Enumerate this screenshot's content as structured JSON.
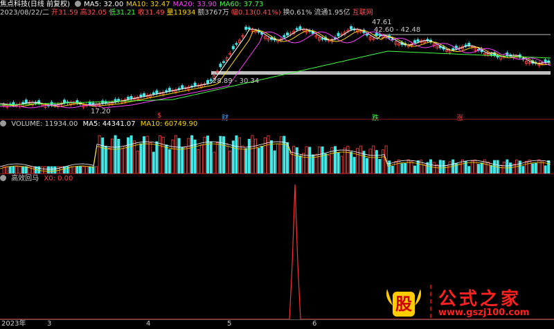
{
  "main": {
    "title": "焦点科技(日线 前复权)",
    "ma_items": [
      {
        "label": "MA5: 32.00",
        "color": "#ffffff"
      },
      {
        "label": "MA10: 32.47",
        "color": "#ffd700"
      },
      {
        "label": "MA20: 33.90",
        "color": "#ff40ff"
      },
      {
        "label": "MA60: 37.73",
        "color": "#40ff40"
      }
    ],
    "info_items": [
      {
        "label": "2023/08/22/二",
        "color": "#cccccc"
      },
      {
        "label": "开31.59",
        "color": "#ff5050"
      },
      {
        "label": "高32.05",
        "color": "#ff5050"
      },
      {
        "label": "低31.21",
        "color": "#40ff40"
      },
      {
        "label": "收31.49",
        "color": "#ff5050"
      },
      {
        "label": "量11934",
        "color": "#ffd700"
      },
      {
        "label": "额3767万",
        "color": "#cccccc"
      },
      {
        "label": "幅0.13(0.41%)",
        "color": "#ff5050"
      },
      {
        "label": "换0.61%",
        "color": "#cccccc"
      },
      {
        "label": "流通1.95亿",
        "color": "#cccccc"
      },
      {
        "label": "互联网",
        "color": "#ff5050"
      }
    ],
    "annotations": {
      "high_price": "47.61",
      "range_top": "42.60 - 42.48",
      "range_mid": "28.89 - 30.34",
      "low_price": "17.20"
    },
    "event_tags": [
      "$",
      "财",
      "跌",
      "涨"
    ]
  },
  "volume": {
    "title": "VOLUME: 11934.00",
    "ma5": "MA5: 44341.07",
    "ma10": "MA10: 60749.90"
  },
  "indicator": {
    "title": "高效回马",
    "x0": "X0: 0.00"
  },
  "axis": {
    "labels": [
      "2023年",
      "3",
      "4",
      "5",
      "6"
    ]
  },
  "watermark": {
    "logo_char": "股",
    "brand": "公式之家",
    "url": "www.gszj100.com"
  },
  "colors": {
    "up": "#ff4040",
    "down": "#40e8e8",
    "ma5": "#ffffff",
    "ma10": "#ffd700",
    "ma20": "#ff40ff",
    "ma60": "#40ff40"
  }
}
